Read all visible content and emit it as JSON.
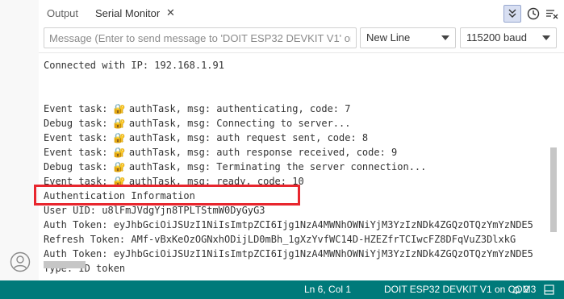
{
  "tabs": {
    "output": "Output",
    "serial_monitor": "Serial Monitor",
    "close": "✕"
  },
  "toolbar": {
    "autoscroll_icon": "double-chevron-down-icon",
    "timestamp_icon": "clock-icon",
    "clear_icon": "clear-output-icon"
  },
  "input": {
    "placeholder": "Message (Enter to send message to 'DOIT ESP32 DEVKIT V1' on '...",
    "value": ""
  },
  "line_ending": {
    "selected": "New Line"
  },
  "baud_rate": {
    "selected": "115200 baud"
  },
  "log": [
    {
      "text": "Connected with IP: 192.168.1.91",
      "lock": false,
      "prefix": "",
      "suffix": ""
    },
    {
      "text": "",
      "lock": false,
      "prefix": "",
      "suffix": ""
    },
    {
      "text": "",
      "lock": false,
      "prefix": "",
      "suffix": ""
    },
    {
      "lock": true,
      "prefix": "Event task: ",
      "suffix": " authTask, msg: authenticating, code: 7"
    },
    {
      "lock": true,
      "prefix": "Debug task: ",
      "suffix": " authTask, msg: Connecting to server..."
    },
    {
      "lock": true,
      "prefix": "Event task: ",
      "suffix": " authTask, msg: auth request sent, code: 8"
    },
    {
      "lock": true,
      "prefix": "Event task: ",
      "suffix": " authTask, msg: auth response received, code: 9"
    },
    {
      "lock": true,
      "prefix": "Debug task: ",
      "suffix": " authTask, msg: Terminating the server connection..."
    },
    {
      "lock": true,
      "prefix": "Event task: ",
      "suffix": " authTask, msg: ready, code: 10"
    },
    {
      "text": "Authentication Information",
      "lock": false
    },
    {
      "text": "User UID: u8lFmJVdgYjn8TPLTStmW0DyGyG3",
      "lock": false
    },
    {
      "text": "Auth Token: eyJhbGciOiJSUzI1NiIsImtpZCI6Ijg1NzA4MWNhOWNiYjM3YzIzNDk4ZGQzOTQzYmYzNDE5",
      "lock": false
    },
    {
      "text": "Refresh Token: AMf-vBxKeOzOGNxhODijLD0mBh_1gXzYvfWC14D-HZEZfrTCIwcFZ8DFqVuZ3DlxkG",
      "lock": false
    },
    {
      "text": "Auth Token: eyJhbGciOiJSUzI1NiIsImtpZCI6Ijg1NzA4MWNhOWNiYjM3YzIzNDk4ZGQzOTQzYmYzNDE5",
      "lock": false
    },
    {
      "text": "Type: ID token",
      "lock": false
    }
  ],
  "status_bar": {
    "position": "Ln 6, Col 1",
    "board": "DOIT ESP32 DEVKIT V1 on COM3",
    "notifications": "2"
  },
  "colors": {
    "status_bar": "#007a7a",
    "highlight": "#e8262e",
    "lock_emoji": "🔐"
  }
}
